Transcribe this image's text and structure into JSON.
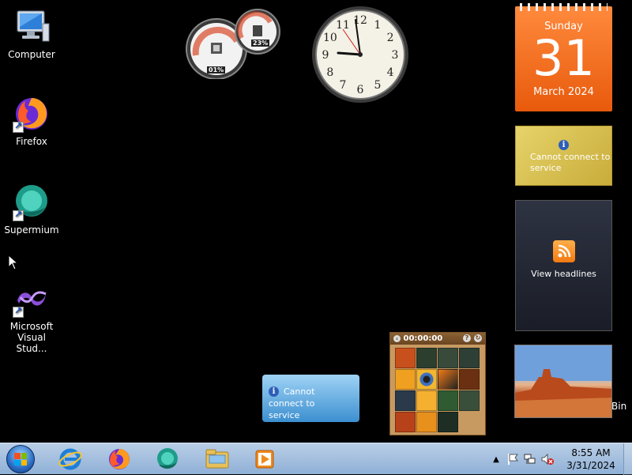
{
  "desktop": {
    "icons": [
      {
        "label": "Computer",
        "icon": "computer-icon"
      },
      {
        "label": "Firefox",
        "icon": "firefox-icon"
      },
      {
        "label": "Supermium",
        "icon": "supermium-icon"
      },
      {
        "label": "Microsoft\nVisual Stud...",
        "icon": "visual-studio-icon"
      }
    ],
    "partial_label": "Bin"
  },
  "gadgets": {
    "cpu_meter": {
      "cpu": "01%",
      "memory": "23%"
    },
    "clock": {
      "hour_numbers": [
        "12",
        "1",
        "2",
        "3",
        "4",
        "5",
        "6",
        "7",
        "8",
        "9",
        "10",
        "11"
      ],
      "time": "8:55"
    },
    "calendar": {
      "weekday": "Sunday",
      "day": "31",
      "month_year": "March 2024"
    },
    "weather": {
      "message": "Cannot connect to service"
    },
    "feed": {
      "label": "View headlines"
    },
    "currency": {
      "message": "Cannot connect to service"
    },
    "puzzle": {
      "timer": "00:00:00",
      "help": "?",
      "shuffle": "↻"
    }
  },
  "taskbar": {
    "pinned": [
      "internet-explorer-icon",
      "firefox-icon",
      "supermium-icon",
      "file-explorer-icon",
      "media-player-icon"
    ],
    "time": "8:55 AM",
    "date": "3/31/2024",
    "tray_icons": [
      "show-hidden-icons-arrow",
      "action-center-flag-icon",
      "network-icon",
      "volume-muted-icon"
    ]
  },
  "colors": {
    "taskbar": "#a9c2e0",
    "calendar": "#f06a1c",
    "weather": "#d8c455",
    "feed_bg": "#232734"
  }
}
